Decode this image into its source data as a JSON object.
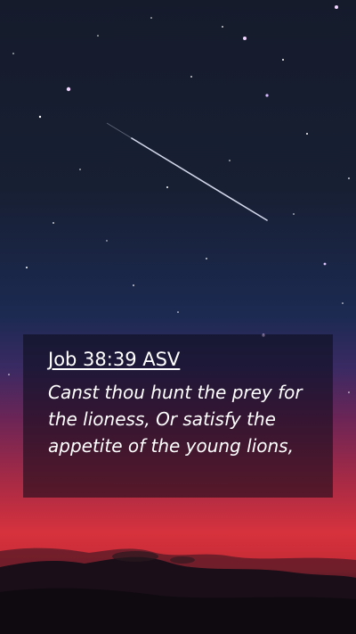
{
  "verse": {
    "reference": "Job 38:39 ASV",
    "text": "Canst thou hunt the prey for the lioness, Or satisfy the appetite of the young lions,"
  },
  "colors": {
    "sky_top": "#151b2b",
    "sky_mid": "#1c2a52",
    "horizon_red": "#d6323d",
    "box_overlay": "rgba(10,10,22,0.55)",
    "text": "#ffffff"
  },
  "icons": {
    "shooting_star": "shooting-star-streak"
  }
}
